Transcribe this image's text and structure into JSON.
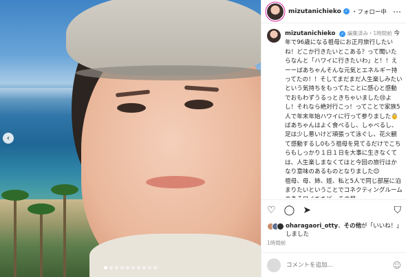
{
  "header": {
    "username": "mizutanichieko",
    "follow_label": "・フォロー中",
    "more_icon": "more-icon"
  },
  "caption": {
    "username": "mizutanichieko",
    "meta": "編集済み・1時間前",
    "text": "今年で96歳になる祖母にお正月旅行したいね！どこか行きたいとこある？って聞いたらなんと「ハワイに行きたいわ」と！！えーーばあちゃんそんな元気とエネルギー持ってたの！！そしてまだまだ人生楽しみたいという気持ちをもってたことに感心と感動でおもわずうるっときちゃいました😢よし！それなら絶対行こっ！ってことで家族5人で年末年始ハワイに行って参りました👵ばあちゃんはよく食べるし、しゃべるし、足は少し悪いけど頑張って泳ぐし、花火観て感動するし0もう祖母を見てるだけでこちらもしっかり１日１日を大事に生きなくては、人生楽しまなくてはと今回の旅行はかなり意味のあるものとなりました😊\n祖母、母、姉、姪、私と5人で同じ部屋に泊まりたいということでコネクティングルームのあるワイキキビーチの目"
  },
  "actions": {
    "like_icon": "heart-icon",
    "comment_icon": "comment-icon",
    "share_icon": "share-icon",
    "save_icon": "bookmark-icon"
  },
  "likes": {
    "user": "oharagaori_otty",
    "middle": "、",
    "others": "その他",
    "suffix": "が「いいね！」しました"
  },
  "posted": "1時間前",
  "comment": {
    "placeholder": "コメントを追加...",
    "emoji_icon": "emoji-icon"
  },
  "carousel": {
    "total": 10,
    "active_index": 0
  },
  "colors": {
    "verified": "#3897f0",
    "story_ring": "#d6249f",
    "secondary_text": "#8e8e8e"
  }
}
